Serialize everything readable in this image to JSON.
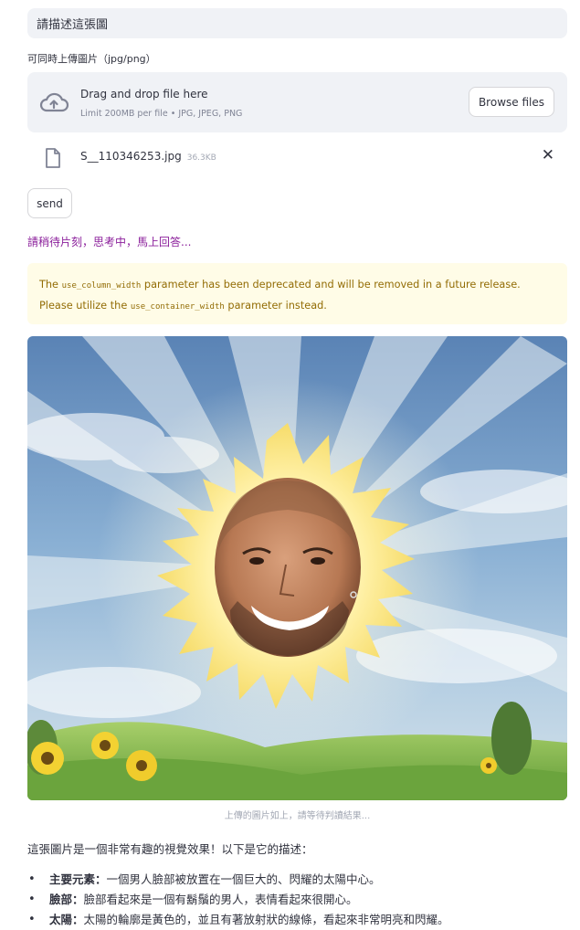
{
  "prompt": {
    "value": "請描述這張圖"
  },
  "uploader": {
    "label": "可同時上傳圖片（jpg/png）",
    "drop_title": "Drag and drop file here",
    "drop_limit": "Limit 200MB per file • JPG, JPEG, PNG",
    "browse_label": "Browse files",
    "icon": "cloud-upload-icon"
  },
  "file": {
    "name": "S__110346253.jpg",
    "size": "36.3KB",
    "icon": "file-icon",
    "close": "✕"
  },
  "send_label": "send",
  "status_text": "請稍待片刻，思考中，馬上回答...",
  "warning": {
    "part1": "The ",
    "code1": "use_column_width",
    "part2": " parameter has been deprecated and will be removed in a future release. Please utilize the ",
    "code2": "use_container_width",
    "part3": " parameter instead."
  },
  "image": {
    "subject": "sun-baby-image",
    "caption": "上傳的圖片如上，請等待判讀結果..."
  },
  "description": {
    "intro": "這張圖片是一個非常有趣的視覺效果！以下是它的描述：",
    "items": [
      {
        "label": "主要元素：",
        "text": "一個男人臉部被放置在一個巨大的、閃耀的太陽中心。"
      },
      {
        "label": "臉部：",
        "text": "臉部看起來是一個有鬍鬚的男人，表情看起來很開心。"
      },
      {
        "label": "太陽：",
        "text": "太陽的輪廓是黃色的，並且有著放射狀的線條，看起來非常明亮和閃耀。"
      }
    ]
  },
  "colors": {
    "status_purple": "#8b1f9b",
    "warning_bg": "#fffce7",
    "warning_text": "#926c05",
    "input_bg": "#f0f2f6"
  }
}
